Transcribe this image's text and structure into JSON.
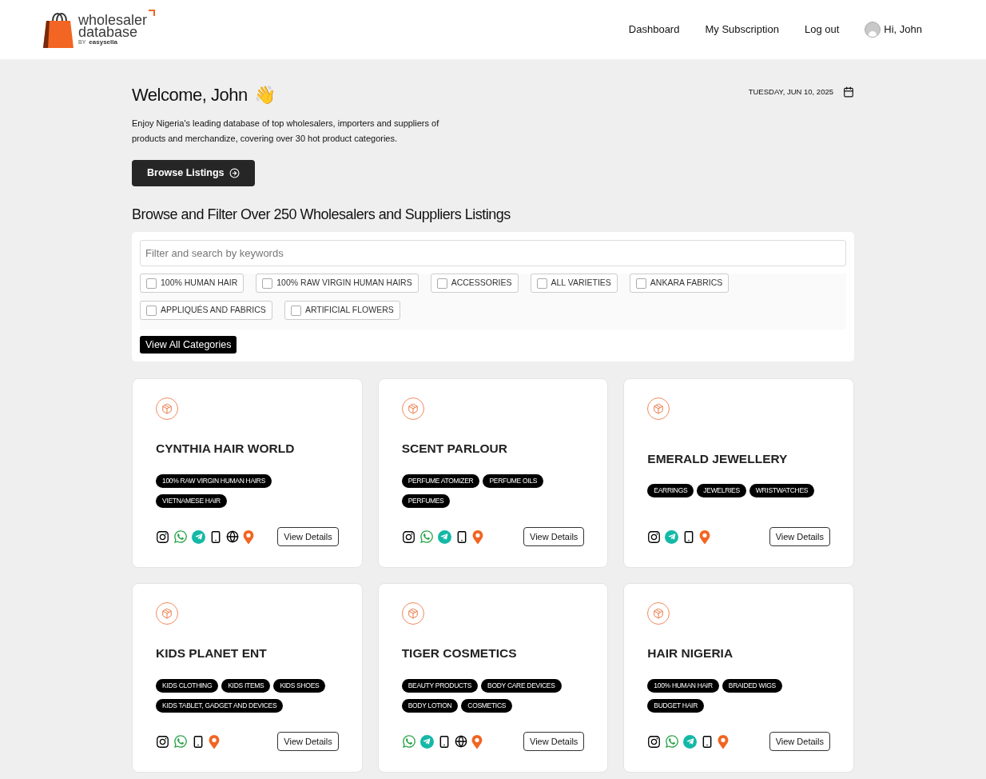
{
  "header": {
    "logo": {
      "line_1": "wholesaler",
      "line_2": "database",
      "by": "BY",
      "brand": "easysella"
    },
    "nav": [
      "Dashboard",
      "My Subscription",
      "Log out"
    ],
    "user": "Hi, John"
  },
  "welcome": {
    "title": "Welcome, John",
    "emoji": "👋",
    "date": "TUESDAY, JUN 10, 2025",
    "description": "Enjoy Nigeria's leading database of top wholesalers, importers and suppliers of products and merchandize, covering over 30 hot product categories.",
    "button": "Browse Listings"
  },
  "filter": {
    "heading": "Browse and Filter Over 250 Wholesalers and Suppliers Listings",
    "search_placeholder": "Filter and search by keywords",
    "categories": [
      {
        "label": "100% HUMAN HAIR",
        "checked": false
      },
      {
        "label": "100% RAW VIRGIN HUMAN HAIRS",
        "checked": false
      },
      {
        "label": "ACCESSORIES",
        "checked": false
      },
      {
        "label": "ALL VARIETIES",
        "checked": false
      },
      {
        "label": "ANKARA FABRICS",
        "checked": false
      },
      {
        "label": "APPLIQUÉS AND FABRICS",
        "checked": false
      },
      {
        "label": "ARTIFICIAL FLOWERS",
        "checked": false
      }
    ],
    "view_all": "View All Categories"
  },
  "listings": [
    {
      "name": "CYNTHIA HAIR WORLD",
      "tags": [
        "100% RAW VIRGIN HUMAN HAIRS",
        "VIETNAMESE HAIR"
      ],
      "contacts": [
        {
          "kind": "instagram"
        },
        {
          "kind": "whatsapp"
        },
        {
          "kind": "telegram"
        },
        {
          "kind": "phone"
        },
        {
          "kind": "web"
        },
        {
          "kind": "location"
        }
      ],
      "button": "View Details"
    },
    {
      "name": "SCENT PARLOUR",
      "tags": [
        "PERFUME ATOMIZER",
        "PERFUME OILS",
        "PERFUMES"
      ],
      "contacts": [
        {
          "kind": "instagram"
        },
        {
          "kind": "whatsapp"
        },
        {
          "kind": "telegram"
        },
        {
          "kind": "phone"
        },
        {
          "kind": "location"
        }
      ],
      "button": "View Details"
    },
    {
      "name": "EMERALD JEWELLERY",
      "tags": [
        "EARRINGS",
        "JEWELRIES",
        "WRISTWATCHES"
      ],
      "contacts": [
        {
          "kind": "instagram"
        },
        {
          "kind": "telegram"
        },
        {
          "kind": "phone"
        },
        {
          "kind": "location"
        }
      ],
      "button": "View Details"
    },
    {
      "name": "KIDS PLANET ENT",
      "tags": [
        "KIDS CLOTHING",
        "KIDS ITEMS",
        "KIDS SHOES",
        "KIDS TABLET, GADGET AND DEVICES"
      ],
      "contacts": [
        {
          "kind": "instagram"
        },
        {
          "kind": "whatsapp"
        },
        {
          "kind": "phone"
        },
        {
          "kind": "location"
        }
      ],
      "button": "View Details"
    },
    {
      "name": "TIGER COSMETICS",
      "tags": [
        "BEAUTY PRODUCTS",
        "BODY CARE DEVICES",
        "BODY LOTION",
        "COSMETICS"
      ],
      "contacts": [
        {
          "kind": "whatsapp"
        },
        {
          "kind": "telegram"
        },
        {
          "kind": "phone"
        },
        {
          "kind": "web"
        },
        {
          "kind": "location"
        }
      ],
      "button": "View Details"
    },
    {
      "name": "HAIR NIGERIA",
      "tags": [
        "100% HUMAN HAIR",
        "BRAIDED WIGS",
        "BUDGET HAIR"
      ],
      "contacts": [
        {
          "kind": "instagram"
        },
        {
          "kind": "whatsapp"
        },
        {
          "kind": "telegram"
        },
        {
          "kind": "phone"
        },
        {
          "kind": "location"
        }
      ],
      "button": "View Details"
    }
  ]
}
